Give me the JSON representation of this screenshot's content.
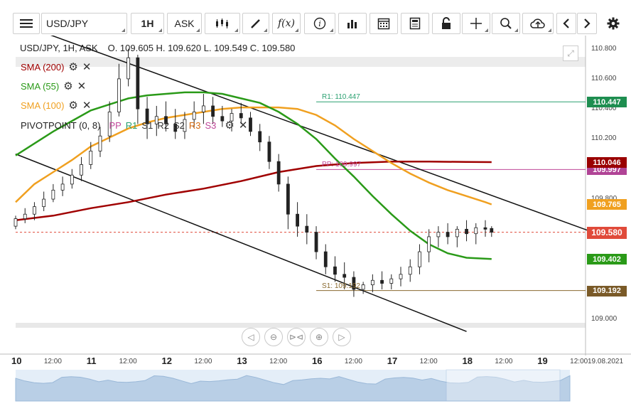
{
  "toolbar": {
    "menu_icon": "hamburger-menu-icon",
    "symbol": "USD/JPY",
    "timeframe": "1H",
    "price_type": "ASK",
    "function_label": "f(x)",
    "info_label": "i"
  },
  "header": {
    "instrument": "USD/JPY, 1H, ASK",
    "ohlc": "O. 109.605  H. 109.620  L. 109.549  C. 109.580"
  },
  "indicators": [
    {
      "label": "SMA (200)",
      "color": "#a00000"
    },
    {
      "label": "SMA (55)",
      "color": "#2a9a18"
    },
    {
      "label": "SMA (100)",
      "color": "#f0a020"
    },
    {
      "label": "PIVOTPOINT (0, 8)",
      "color": "#222222"
    }
  ],
  "pivot_series": [
    {
      "label": "PP",
      "color": "#c0489a"
    },
    {
      "label": "R1",
      "color": "#2aa070"
    },
    {
      "label": "S1",
      "color": "#333333"
    },
    {
      "label": "R2",
      "color": "#333333"
    },
    {
      "label": "S2",
      "color": "#333333"
    },
    {
      "label": "R3",
      "color": "#d46a10"
    },
    {
      "label": "S3",
      "color": "#c0489a"
    }
  ],
  "chart_data": {
    "type": "candlestick",
    "symbol": "USD/JPY",
    "timeframe": "1H",
    "price_type": "ASK",
    "ohlc_last": {
      "open": 109.605,
      "high": 109.62,
      "low": 109.549,
      "close": 109.58
    },
    "current_price": 109.58,
    "yaxis": {
      "ylim": [
        108.935,
        110.85
      ],
      "ticks": [
        110.8,
        110.6,
        110.4,
        110.2,
        109.8,
        109.0
      ]
    },
    "xaxis": {
      "day_ticks": [
        {
          "label": "10",
          "t": 0
        },
        {
          "label": "11",
          "t": 24
        },
        {
          "label": "12",
          "t": 48
        },
        {
          "label": "13",
          "t": 72
        },
        {
          "label": "16",
          "t": 96
        },
        {
          "label": "17",
          "t": 120
        },
        {
          "label": "18",
          "t": 144
        },
        {
          "label": "19",
          "t": 168
        }
      ],
      "hour_ticks": [
        {
          "label": "12:00",
          "t": 12
        },
        {
          "label": "12:00",
          "t": 36
        },
        {
          "label": "12:00",
          "t": 60
        },
        {
          "label": "12:00",
          "t": 84
        },
        {
          "label": "12:00",
          "t": 108
        },
        {
          "label": "12:00",
          "t": 132
        },
        {
          "label": "12:00",
          "t": 156
        },
        {
          "label": "12:00",
          "t": 180
        }
      ],
      "end_label": "19.08.2021"
    },
    "levels": [
      {
        "label": "R1: 110.447",
        "value": 110.447,
        "tag": "110.447",
        "color": "#2aa070",
        "tag_bg": "#1e8e50"
      },
      {
        "label": "PP: 109.997",
        "value": 109.997,
        "tag": "109.997",
        "color": "#c0489a",
        "tag_bg": "#b04496"
      },
      {
        "label": "S1: 109.192",
        "value": 109.192,
        "tag": "109.192",
        "color": "#8a6a30",
        "tag_bg": "#7a5a28"
      }
    ],
    "ma_tags": [
      {
        "name": "SMA (200)",
        "value": 110.046,
        "tag": "110.046",
        "bg": "#9a0000"
      },
      {
        "name": "SMA (100)",
        "value": 109.765,
        "tag": "109.765",
        "bg": "#f0a020"
      },
      {
        "name": "SMA (55)",
        "value": 109.402,
        "tag": "109.402",
        "bg": "#2a9a18"
      }
    ],
    "price_tag": {
      "value": 109.58,
      "tag": "109.580",
      "bg": "#e04a3a"
    },
    "series": [
      {
        "name": "SMA (200)",
        "color": "#a00000",
        "points": [
          [
            0,
            109.66
          ],
          [
            12,
            109.69
          ],
          [
            24,
            109.74
          ],
          [
            36,
            109.78
          ],
          [
            48,
            109.83
          ],
          [
            60,
            109.87
          ],
          [
            72,
            109.92
          ],
          [
            84,
            109.98
          ],
          [
            96,
            110.02
          ],
          [
            108,
            110.04
          ],
          [
            120,
            110.05
          ],
          [
            132,
            110.05
          ],
          [
            144,
            110.047
          ],
          [
            152,
            110.046
          ]
        ]
      },
      {
        "name": "SMA (100)",
        "color": "#f0a020",
        "points": [
          [
            0,
            109.78
          ],
          [
            6,
            109.9
          ],
          [
            12,
            109.98
          ],
          [
            18,
            110.06
          ],
          [
            24,
            110.15
          ],
          [
            30,
            110.21
          ],
          [
            36,
            110.27
          ],
          [
            42,
            110.31
          ],
          [
            48,
            110.34
          ],
          [
            54,
            110.36
          ],
          [
            60,
            110.38
          ],
          [
            66,
            110.4
          ],
          [
            72,
            110.41
          ],
          [
            78,
            110.41
          ],
          [
            84,
            110.41
          ],
          [
            90,
            110.4
          ],
          [
            96,
            110.36
          ],
          [
            102,
            110.29
          ],
          [
            108,
            110.2
          ],
          [
            114,
            110.12
          ],
          [
            120,
            110.04
          ],
          [
            126,
            109.97
          ],
          [
            132,
            109.91
          ],
          [
            138,
            109.86
          ],
          [
            144,
            109.82
          ],
          [
            150,
            109.78
          ],
          [
            152,
            109.765
          ]
        ]
      },
      {
        "name": "SMA (55)",
        "color": "#2a9a18",
        "points": [
          [
            0,
            110.09
          ],
          [
            6,
            110.17
          ],
          [
            12,
            110.25
          ],
          [
            18,
            110.32
          ],
          [
            24,
            110.39
          ],
          [
            30,
            110.43
          ],
          [
            36,
            110.47
          ],
          [
            42,
            110.49
          ],
          [
            48,
            110.5
          ],
          [
            54,
            110.51
          ],
          [
            60,
            110.51
          ],
          [
            66,
            110.5
          ],
          [
            72,
            110.47
          ],
          [
            78,
            110.44
          ],
          [
            84,
            110.38
          ],
          [
            90,
            110.3
          ],
          [
            96,
            110.2
          ],
          [
            102,
            110.07
          ],
          [
            108,
            109.95
          ],
          [
            114,
            109.82
          ],
          [
            120,
            109.7
          ],
          [
            126,
            109.59
          ],
          [
            132,
            109.5
          ],
          [
            138,
            109.44
          ],
          [
            144,
            109.41
          ],
          [
            152,
            109.402
          ]
        ]
      }
    ],
    "trend_lines": [
      {
        "from": [
          10,
          110.9
        ],
        "to": [
          183,
          109.59
        ]
      },
      {
        "from": [
          0,
          110.1
        ],
        "to": [
          144,
          108.92
        ]
      }
    ],
    "candles": [
      [
        0,
        109.62,
        109.69,
        109.6,
        109.67
      ],
      [
        3,
        109.67,
        109.74,
        109.64,
        109.7
      ],
      [
        6,
        109.7,
        109.78,
        109.66,
        109.75
      ],
      [
        9,
        109.75,
        109.85,
        109.72,
        109.8
      ],
      [
        12,
        109.8,
        109.9,
        109.78,
        109.86
      ],
      [
        15,
        109.86,
        109.95,
        109.82,
        109.9
      ],
      [
        18,
        109.9,
        110.0,
        109.87,
        109.96
      ],
      [
        21,
        109.96,
        110.08,
        109.92,
        110.03
      ],
      [
        24,
        110.03,
        110.18,
        110.0,
        110.12
      ],
      [
        27,
        110.12,
        110.28,
        110.08,
        110.22
      ],
      [
        30,
        110.22,
        110.45,
        110.18,
        110.38
      ],
      [
        33,
        110.38,
        110.7,
        110.35,
        110.6
      ],
      [
        36,
        110.6,
        110.8,
        110.55,
        110.74
      ],
      [
        39,
        110.74,
        110.76,
        110.3,
        110.4
      ],
      [
        42,
        110.4,
        110.48,
        110.2,
        110.3
      ],
      [
        45,
        110.3,
        110.42,
        110.22,
        110.35
      ],
      [
        48,
        110.35,
        110.45,
        110.25,
        110.3
      ],
      [
        51,
        110.3,
        110.4,
        110.2,
        110.25
      ],
      [
        54,
        110.25,
        110.38,
        110.2,
        110.33
      ],
      [
        57,
        110.33,
        110.45,
        110.28,
        110.38
      ],
      [
        60,
        110.38,
        110.5,
        110.3,
        110.42
      ],
      [
        63,
        110.42,
        110.48,
        110.3,
        110.35
      ],
      [
        66,
        110.35,
        110.42,
        110.28,
        110.32
      ],
      [
        69,
        110.32,
        110.4,
        110.25,
        110.37
      ],
      [
        72,
        110.37,
        110.44,
        110.3,
        110.34
      ],
      [
        75,
        110.34,
        110.38,
        110.22,
        110.25
      ],
      [
        78,
        110.25,
        110.3,
        110.12,
        110.18
      ],
      [
        81,
        110.18,
        110.22,
        110.0,
        110.05
      ],
      [
        84,
        110.05,
        110.1,
        109.85,
        109.9
      ],
      [
        87,
        109.9,
        109.95,
        109.6,
        109.7
      ],
      [
        90,
        109.7,
        109.78,
        109.55,
        109.62
      ],
      [
        93,
        109.62,
        109.7,
        109.5,
        109.58
      ],
      [
        96,
        109.58,
        109.62,
        109.4,
        109.45
      ],
      [
        99,
        109.45,
        109.5,
        109.3,
        109.35
      ],
      [
        102,
        109.35,
        109.42,
        109.25,
        109.3
      ],
      [
        105,
        109.3,
        109.38,
        109.2,
        109.28
      ],
      [
        108,
        109.28,
        109.32,
        109.15,
        109.2
      ],
      [
        111,
        109.2,
        109.25,
        109.17,
        109.23
      ],
      [
        114,
        109.23,
        109.3,
        109.18,
        109.26
      ],
      [
        117,
        109.26,
        109.32,
        109.2,
        109.24
      ],
      [
        120,
        109.24,
        109.3,
        109.2,
        109.27
      ],
      [
        123,
        109.27,
        109.35,
        109.22,
        109.3
      ],
      [
        126,
        109.3,
        109.4,
        109.25,
        109.35
      ],
      [
        129,
        109.35,
        109.5,
        109.3,
        109.45
      ],
      [
        132,
        109.45,
        109.6,
        109.38,
        109.55
      ],
      [
        135,
        109.55,
        109.62,
        109.48,
        109.58
      ],
      [
        138,
        109.58,
        109.64,
        109.5,
        109.55
      ],
      [
        141,
        109.55,
        109.62,
        109.48,
        109.6
      ],
      [
        144,
        109.6,
        109.66,
        109.52,
        109.57
      ],
      [
        147,
        109.57,
        109.64,
        109.5,
        109.61
      ],
      [
        150,
        109.61,
        109.66,
        109.55,
        109.6
      ],
      [
        152,
        109.605,
        109.62,
        109.549,
        109.58
      ]
    ]
  }
}
